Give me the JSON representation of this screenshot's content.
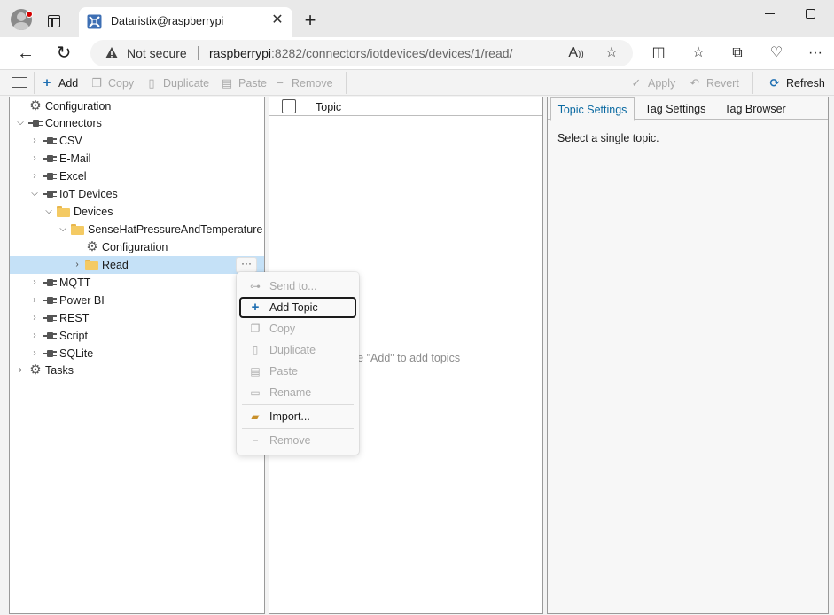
{
  "browser": {
    "tab_title": "Dataristix@raspberrypi",
    "tab_close": "✕",
    "new_tab": "+",
    "security_label": "Not secure",
    "url_host": "raspberrypi",
    "url_rest": ":8282/connectors/iotdevices/devices/1/read/"
  },
  "toolbar": {
    "add": "Add",
    "copy": "Copy",
    "duplicate": "Duplicate",
    "paste": "Paste",
    "remove": "Remove",
    "apply": "Apply",
    "revert": "Revert",
    "refresh": "Refresh"
  },
  "tree": {
    "configuration": "Configuration",
    "connectors": "Connectors",
    "csv": "CSV",
    "email": "E-Mail",
    "excel": "Excel",
    "iot_devices": "IoT Devices",
    "devices": "Devices",
    "sensehat": "SenseHatPressureAndTemperature",
    "sensehat_configuration": "Configuration",
    "read": "Read",
    "mqtt": "MQTT",
    "powerbi": "Power BI",
    "rest": "REST",
    "script": "Script",
    "sqlite": "SQLite",
    "tasks": "Tasks",
    "more": "···"
  },
  "topics": {
    "column_topic": "Topic",
    "empty_message": "se \"Add\" to add topics"
  },
  "settings": {
    "tabs": [
      "Topic Settings",
      "Tag Settings",
      "Tag Browser"
    ],
    "message": "Select a single topic."
  },
  "context_menu": {
    "send_to": "Send to...",
    "add_topic": "Add Topic",
    "copy": "Copy",
    "duplicate": "Duplicate",
    "paste": "Paste",
    "rename": "Rename",
    "import": "Import...",
    "remove": "Remove"
  },
  "colors": {
    "selection": "#c5e1f7",
    "active_tab_text": "#0b6aa2",
    "add_icon": "#1f6fb2",
    "refresh_icon": "#1f6fb2"
  }
}
